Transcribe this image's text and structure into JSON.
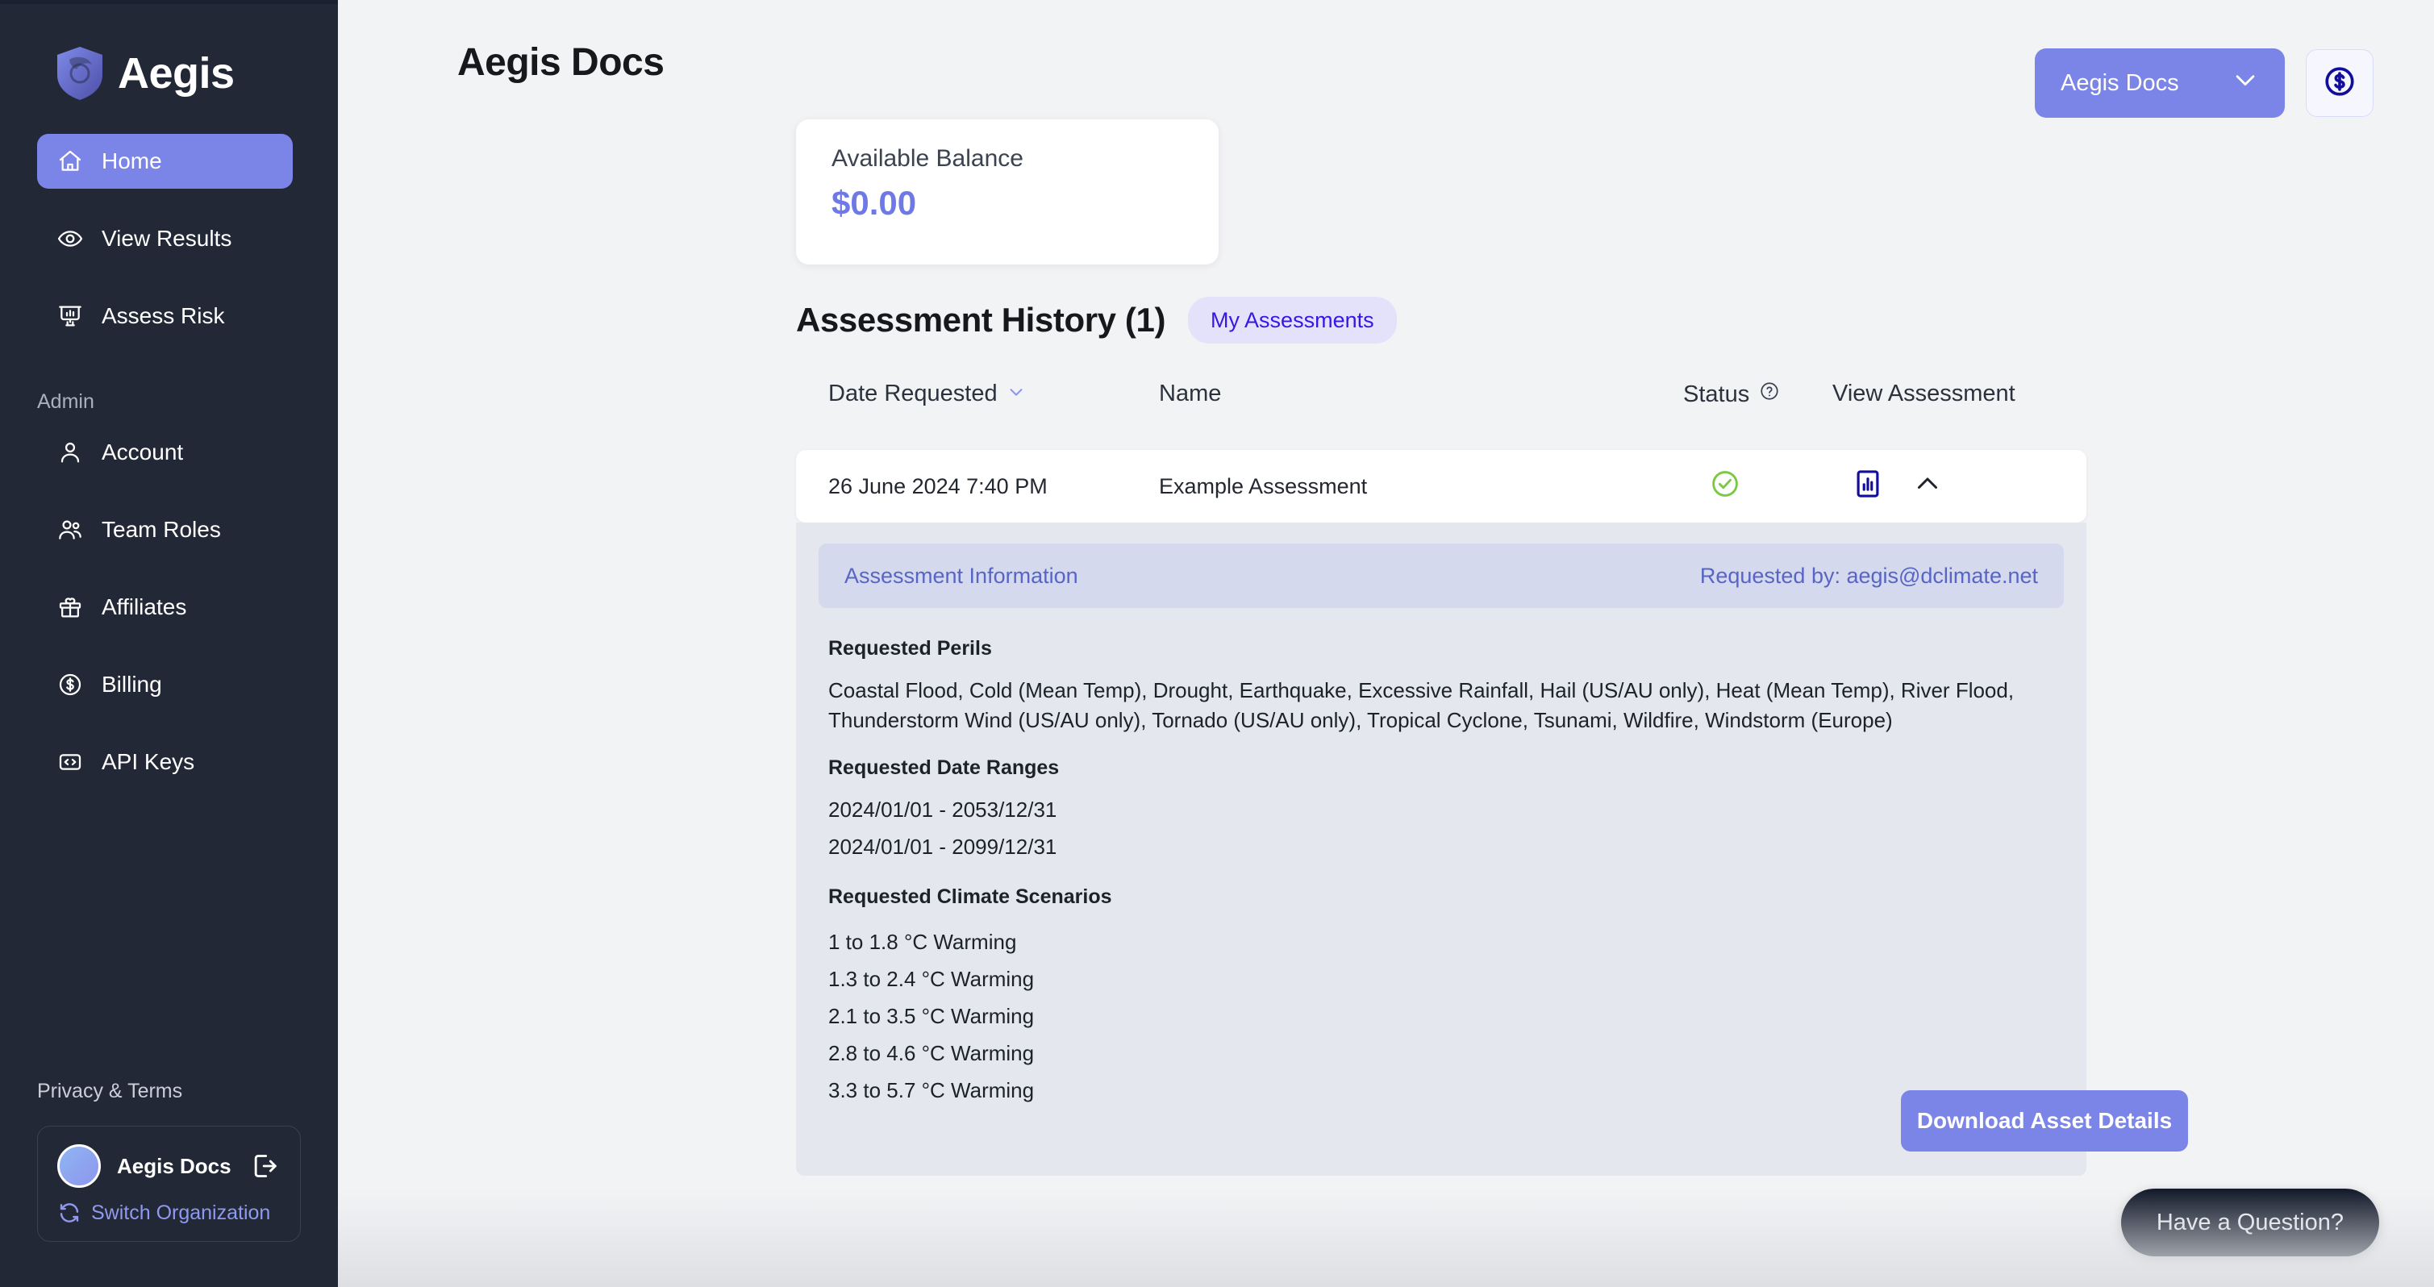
{
  "brand": {
    "name": "Aegis",
    "logo_icon": "aegis-shield-logo"
  },
  "sidebar": {
    "main_items": [
      {
        "label": "Home",
        "icon": "home-icon",
        "active": true
      },
      {
        "label": "View Results",
        "icon": "eye-icon",
        "active": false
      },
      {
        "label": "Assess Risk",
        "icon": "presentation-chart-icon",
        "active": false
      }
    ],
    "admin_section_label": "Admin",
    "admin_items": [
      {
        "label": "Account",
        "icon": "user-icon"
      },
      {
        "label": "Team Roles",
        "icon": "users-icon"
      },
      {
        "label": "Affiliates",
        "icon": "gift-icon"
      },
      {
        "label": "Billing",
        "icon": "dollar-circle-icon"
      },
      {
        "label": "API Keys",
        "icon": "code-brackets-icon"
      }
    ],
    "privacy_link": "Privacy & Terms",
    "org": {
      "name": "Aegis Docs",
      "switch_label": "Switch Organization",
      "switch_icon": "refresh-icon",
      "logout_icon": "logout-icon",
      "avatar_icon": "avatar"
    }
  },
  "header": {
    "page_title": "Aegis Docs",
    "org_dropdown_label": "Aegis Docs",
    "org_dropdown_icon": "chevron-down-icon",
    "billing_icon": "dollar-circle-icon"
  },
  "balance_card": {
    "label": "Available Balance",
    "value": "$0.00"
  },
  "history": {
    "title": "Assessment History (1)",
    "pill_label": "My Assessments",
    "columns": {
      "date": "Date Requested",
      "date_sort_icon": "chevron-down-icon",
      "name": "Name",
      "status": "Status",
      "status_help_icon": "question-circle-icon",
      "view": "View Assessment"
    },
    "rows": [
      {
        "date": "26 June 2024 7:40 PM",
        "name": "Example Assessment",
        "status_icon": "check-circle-icon",
        "status_color": "#7ac943",
        "view_icon": "bar-chart-icon",
        "expand_icon": "chevron-up-icon",
        "expanded": true
      }
    ]
  },
  "details": {
    "info_title": "Assessment Information",
    "requested_by": "Requested by: aegis@dclimate.net",
    "perils_label": "Requested Perils",
    "perils_text": "Coastal Flood, Cold (Mean Temp), Drought, Earthquake, Excessive Rainfall, Hail (US/AU only), Heat (Mean Temp), River Flood, Thunderstorm Wind (US/AU only), Tornado (US/AU only), Tropical Cyclone, Tsunami, Wildfire, Windstorm (Europe)",
    "date_ranges_label": "Requested Date Ranges",
    "date_ranges": [
      "2024/01/01 - 2053/12/31",
      "2024/01/01 - 2099/12/31"
    ],
    "scenarios_label": "Requested Climate Scenarios",
    "scenarios": [
      "1 to 1.8 °C Warming",
      "1.3 to 2.4 °C Warming",
      "2.1 to 3.5 °C Warming",
      "2.8 to 4.6 °C Warming",
      "3.3 to 5.7 °C Warming"
    ],
    "download_label": "Download Asset Details"
  },
  "chat_widget": {
    "label": "Have a Question?"
  },
  "colors": {
    "accent": "#7b85e8",
    "sidebar_bg": "#222836",
    "page_bg": "#f2f3f5",
    "panel_bg": "#e4e7ed",
    "info_bar_bg": "#d4d9ee",
    "link": "#5865c4",
    "status_success": "#7ac943",
    "pill_text": "#3417e3",
    "pill_bg": "#e4e2fb"
  }
}
